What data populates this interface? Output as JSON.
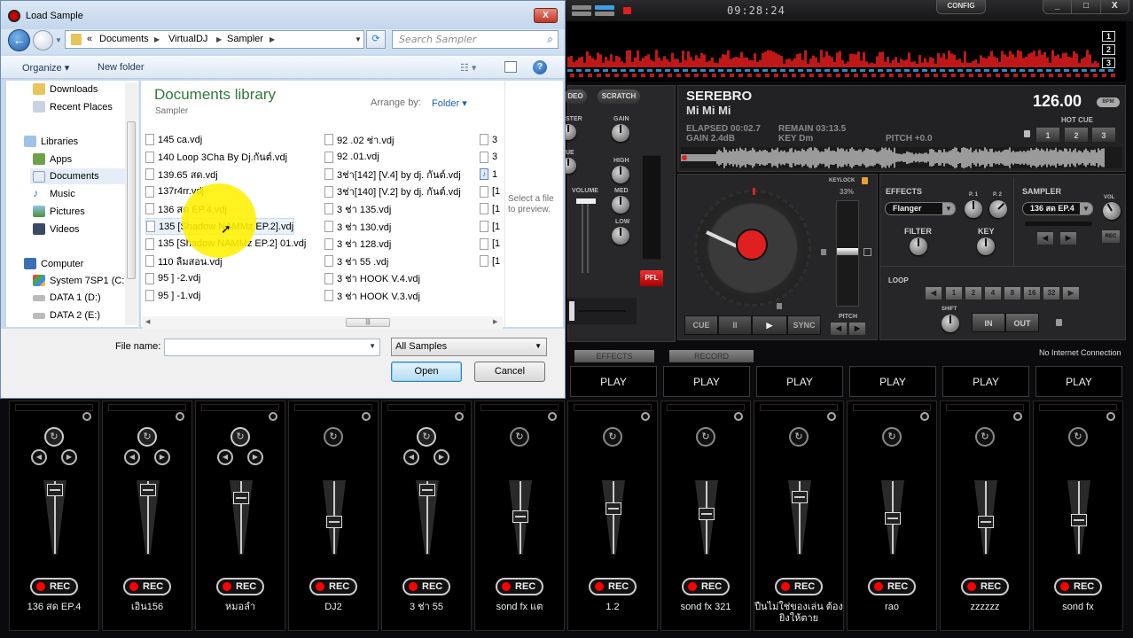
{
  "dialog": {
    "title": "Load Sample",
    "breadcrumb": [
      "«",
      "Documents",
      "VirtualDJ",
      "Sampler"
    ],
    "search_placeholder": "Search Sampler",
    "toolbar": {
      "organize": "Organize ▾",
      "new_folder": "New folder"
    },
    "nav": {
      "favorites": [
        "Downloads",
        "Recent Places"
      ],
      "libraries_header": "Libraries",
      "libraries": [
        "Apps",
        "Documents",
        "Music",
        "Pictures",
        "Videos"
      ],
      "selected": "Documents",
      "computer_header": "Computer",
      "drives": [
        "System 7SP1 (C:)",
        "DATA 1 (D:)",
        "DATA 2 (E:)"
      ]
    },
    "library_title": "Documents library",
    "library_subtitle": "Sampler",
    "arrange_by_label": "Arrange by:",
    "arrange_by_value": "Folder ▾",
    "files_col1": [
      "145 ca.vdj",
      "140 Loop 3Cha By Dj.กันต์.vdj",
      "139.65 สด.vdj",
      "137r4rr.vdj",
      "136 สด EP.4.vdj",
      "135 [Shadow NAMMz EP.2].vdj",
      "135 [Shadow NAMMz EP.2] 01.vdj",
      "110 ลืมสอน.vdj",
      "95 ] -2.vdj",
      "95 ] -1.vdj"
    ],
    "files_col2": [
      "92 .02 ช่า.vdj",
      "92 .01.vdj",
      "3ช่า[142] [V.4] by dj. กันต์.vdj",
      "3ช่า[140] [V.2] by dj. กันต์.vdj",
      "3 ช่า 135.vdj",
      "3 ช่า 130.vdj",
      "3 ช่า 128.vdj",
      "3 ช่า 55 .vdj",
      "3 ช่า  HOOK V.4.vdj",
      "3 ช่า  HOOK V.3.vdj"
    ],
    "files_col3": [
      "3",
      "3",
      "1",
      "[1",
      "[1",
      "[1",
      "[1",
      "[1"
    ],
    "hovered_file": "135 [Shadow NAMMz EP.2].vdj",
    "preview_text": "Select a file to preview.",
    "file_name_label": "File name:",
    "file_name_value": "",
    "file_type": "All Samples",
    "open_label": "Open",
    "cancel_label": "Cancel",
    "close_glyph": "X"
  },
  "vdj": {
    "clock": "09:28:24",
    "config_label": "CONFIG",
    "window_buttons": [
      "_",
      "□",
      "X"
    ],
    "deck_numbers": [
      "1",
      "2",
      "3"
    ],
    "mixer": {
      "video_label": "VIDEO",
      "scratch_label": "SCRATCH",
      "master_label": "MASTER",
      "cue_label": "CUE",
      "gain_label": "GAIN",
      "high_label": "HIGH",
      "med_label": "MED",
      "low_label": "LOW",
      "volume_label": "VOLUME",
      "pfl_label": "PFL"
    },
    "deck": {
      "artist": "SEREBRO",
      "title": "Mi Mi Mi",
      "elapsed": "ELAPSED 00:02.7",
      "remain": "REMAIN 03:13.5",
      "gain": "GAIN 2.4dB",
      "key": "KEY Dm",
      "pitch": "PITCH +0.0",
      "bpm": "126.00",
      "bpm_badge": "BPM",
      "hot_cue_label": "HOT CUE",
      "hot_cues": [
        "1",
        "2",
        "3"
      ],
      "keylock_label": "KEYLOCK",
      "keylock_pct": "33%",
      "pitch_label": "PITCH",
      "transport": {
        "cue": "CUE",
        "pause": "II",
        "play": "▶",
        "sync": "SYNC"
      }
    },
    "effects": {
      "label": "EFFECTS",
      "selected": "Flanger",
      "p1": "P. 1",
      "p2": "P. 2",
      "filter": "FILTER",
      "key": "KEY"
    },
    "sampler": {
      "label": "SAMPLER",
      "selected": "136 สด EP.4",
      "vol": "VOL",
      "rec": "REC"
    },
    "loop": {
      "label": "LOOP",
      "sizes": [
        "1",
        "2",
        "4",
        "8",
        "16",
        "32"
      ],
      "shift": "SHIFT",
      "in": "IN",
      "out": "OUT"
    },
    "tabs": [
      "EFFECTS",
      "RECORD"
    ],
    "status": "No Internet Connection",
    "play_label": "PLAY",
    "rec_label": "REC",
    "slots": [
      {
        "name": "136 สด EP.4",
        "volume": 0.95,
        "loop": true
      },
      {
        "name": "เอิน156",
        "volume": 0.95,
        "loop": true
      },
      {
        "name": "หมอลำ",
        "volume": 0.82,
        "loop": true
      },
      {
        "name": "DJ2",
        "volume": 0.42,
        "loop": false
      },
      {
        "name": "3 ช่า 55",
        "volume": 0.95,
        "loop": true
      },
      {
        "name": "sond fx แต",
        "volume": 0.52,
        "loop": false
      },
      {
        "name": "1.2",
        "volume": 0.65,
        "loop": false
      },
      {
        "name": "sond fx 321",
        "volume": 0.56,
        "loop": false
      },
      {
        "name": "ปืนไม่ใช่ของเล่น ต้องยิงให้ตาย",
        "volume": 0.84,
        "loop": false
      },
      {
        "name": "rao",
        "volume": 0.49,
        "loop": false
      },
      {
        "name": "zzzzzz",
        "volume": 0.42,
        "loop": false
      },
      {
        "name": "sond fx",
        "volume": 0.45,
        "loop": false
      }
    ]
  }
}
